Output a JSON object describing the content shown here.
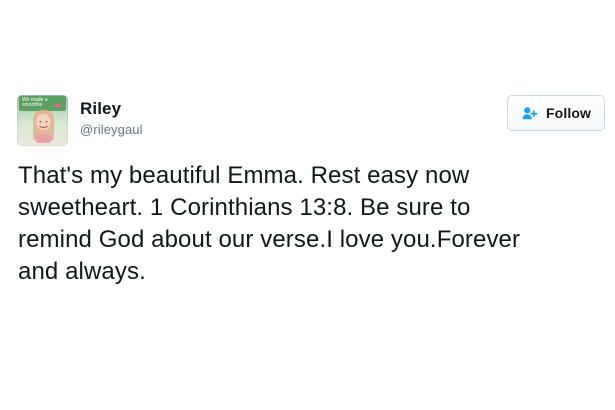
{
  "tweet": {
    "author": {
      "display_name": "Riley",
      "username": "@rileygaul",
      "avatar_caption_lines": [
        "We made a",
        "smoothie"
      ]
    },
    "follow_button": {
      "label": "Follow",
      "icon": "add-user-icon"
    },
    "text_lines": [
      "That's my beautiful Emma. Rest easy now",
      "sweetheart. 1 Corinthians 13:8. Be sure to",
      "remind God about our verse.I love you.Forever",
      "and always."
    ]
  },
  "colors": {
    "text_primary": "#14171a",
    "text_secondary": "#657786",
    "button_border": "#cfd7de",
    "follow_icon_blue": "#1da1f2",
    "avatar_green": "#569d5f"
  }
}
